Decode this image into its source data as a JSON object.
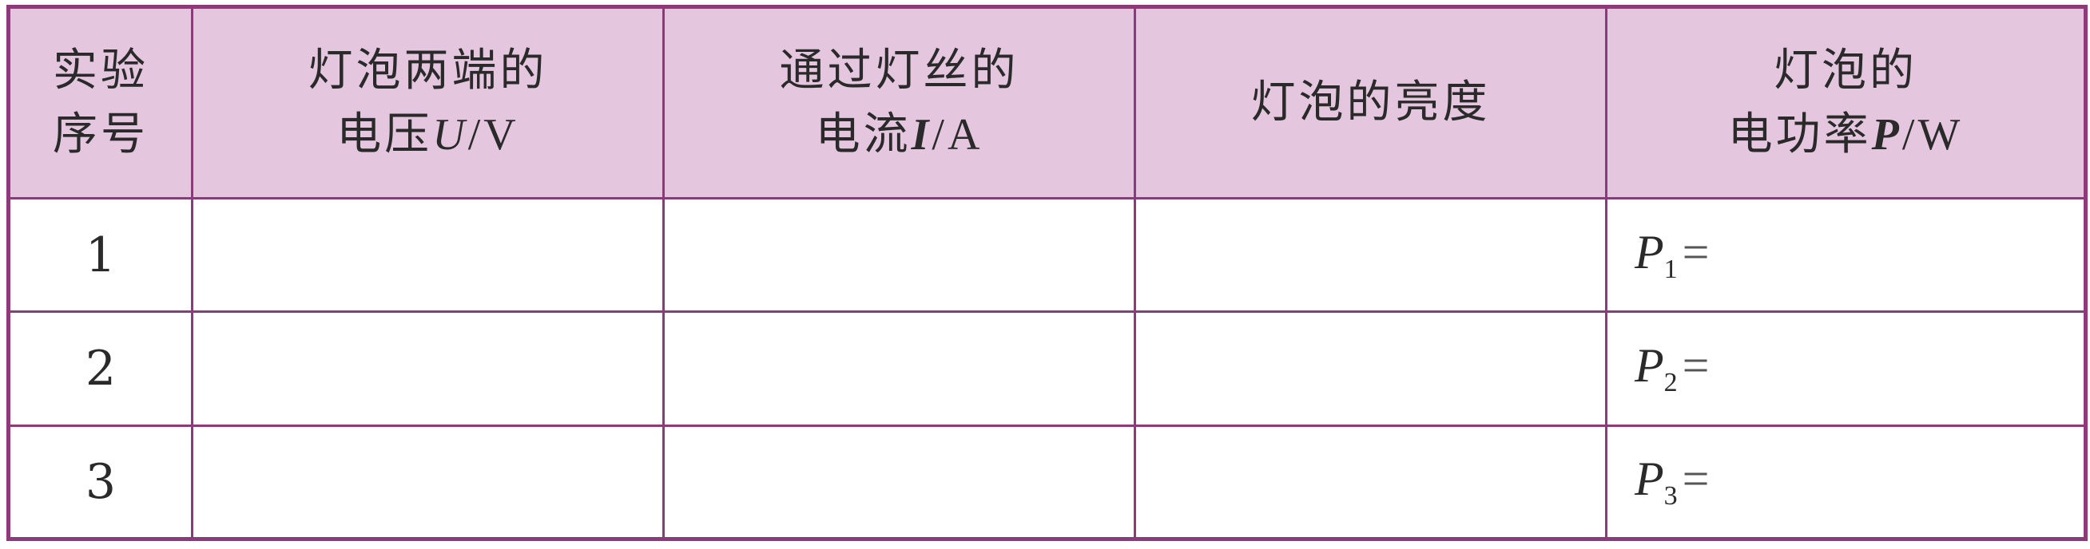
{
  "header": {
    "col1_line1": "实验",
    "col1_line2": "序号",
    "col2_line1": "灯泡两端的",
    "col2_line2_prefix": "电压",
    "col2_line2_symbol": "U",
    "col2_line2_unit": "/V",
    "col3_line1": "通过灯丝的",
    "col3_line2_prefix": "电流",
    "col3_line2_symbol": "I",
    "col3_line2_unit": "/A",
    "col4": "灯泡的亮度",
    "col5_line1": "灯泡的",
    "col5_line2_prefix": "电功率",
    "col5_line2_symbol": "P",
    "col5_line2_unit": "/W"
  },
  "rows": [
    {
      "index": "1",
      "power_symbol": "P",
      "power_sub": "1",
      "power_eq": "="
    },
    {
      "index": "2",
      "power_symbol": "P",
      "power_sub": "2",
      "power_eq": "="
    },
    {
      "index": "3",
      "power_symbol": "P",
      "power_sub": "3",
      "power_eq": "="
    }
  ],
  "colors": {
    "border": "#8e3a7a",
    "header_bg": "#e4c7df"
  }
}
